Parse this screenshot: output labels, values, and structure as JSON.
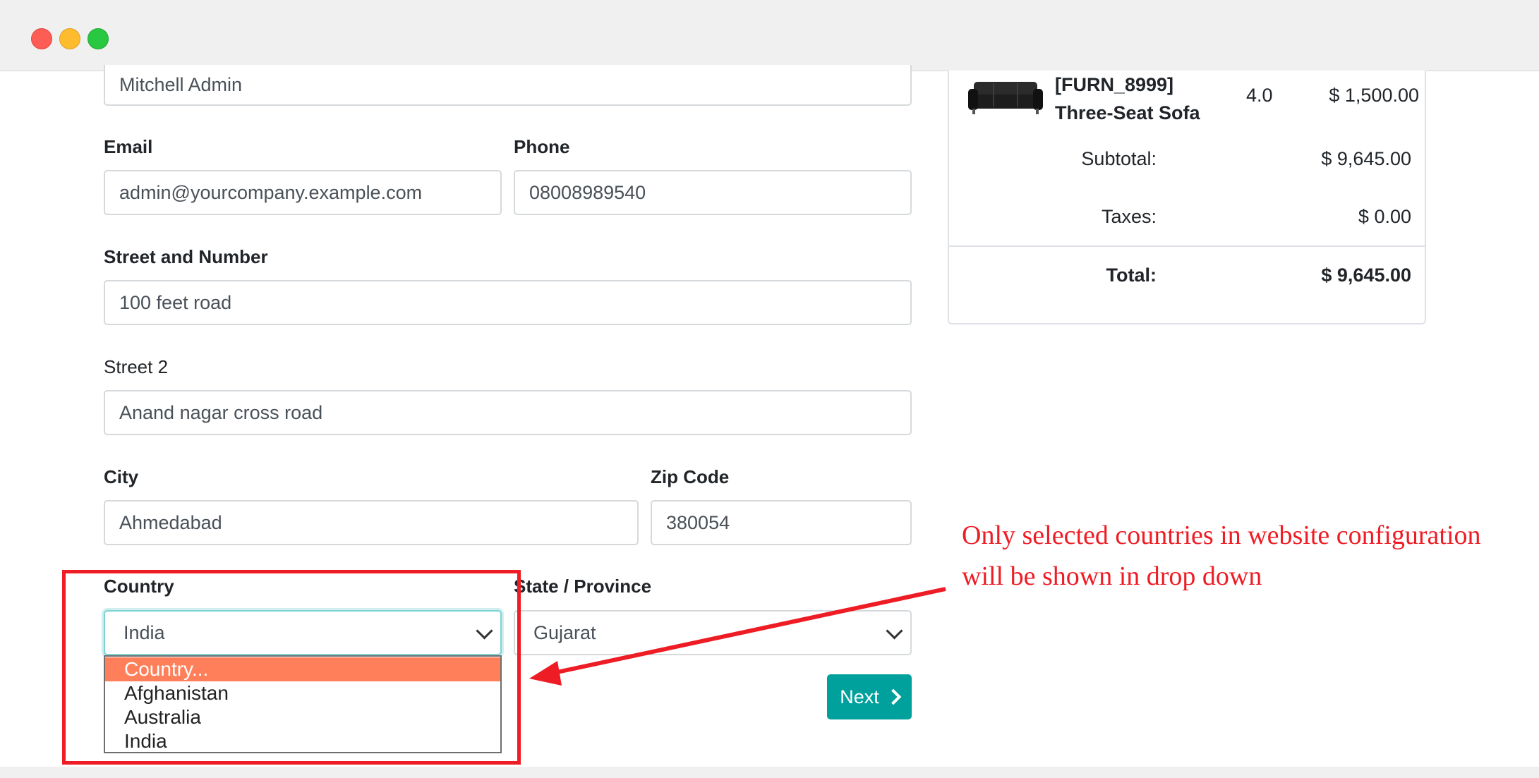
{
  "form": {
    "name_value": "Mitchell Admin",
    "email_label": "Email",
    "email_value": "admin@yourcompany.example.com",
    "phone_label": "Phone",
    "phone_value": "08008989540",
    "street_label": "Street and Number",
    "street_value": "100 feet road",
    "street2_label": "Street 2",
    "street2_value": "Anand nagar cross road",
    "city_label": "City",
    "city_value": "Ahmedabad",
    "zip_label": "Zip Code",
    "zip_value": "380054",
    "country_label": "Country",
    "country_value": "India",
    "state_label": "State / Province",
    "state_value": "Gujarat",
    "country_options": [
      "Country...",
      "Afghanistan",
      "Australia",
      "India"
    ],
    "highlighted_option": "Country...",
    "next_label": "Next"
  },
  "summary": {
    "product_name": "[FURN_8999] Three-Seat Sofa",
    "product_qty": "4.0",
    "product_price": "$ 1,500.00",
    "subtotal_label": "Subtotal:",
    "subtotal_value": "$ 9,645.00",
    "taxes_label": "Taxes:",
    "taxes_value": "$ 0.00",
    "total_label": "Total:",
    "total_value": "$ 9,645.00"
  },
  "annotation": {
    "text": "Only selected countries in website configuration will be shown in drop down"
  },
  "colors": {
    "accent": "#00a09d",
    "annotation": "#ee1c24",
    "dropdown_highlight": "#ff7f5a"
  },
  "icons": {
    "window_controls": [
      "close-dot",
      "minimize-dot",
      "maximize-dot"
    ],
    "select_arrow": "chevron-down-icon",
    "next_arrow": "chevron-right-icon"
  }
}
